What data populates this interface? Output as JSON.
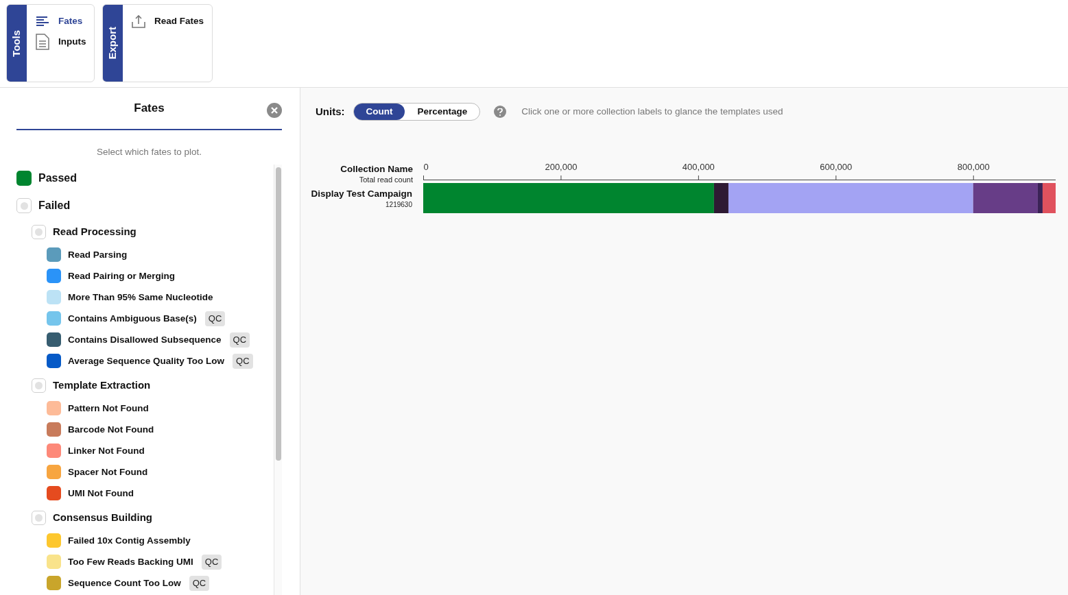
{
  "toolbar": [
    {
      "tab": "Tools",
      "items": [
        {
          "label": "Fates",
          "kind": "lines",
          "selected": true
        },
        {
          "label": "Inputs",
          "kind": "document",
          "selected": false
        }
      ]
    },
    {
      "tab": "Export",
      "items": [
        {
          "label": "Read Fates",
          "kind": "upload",
          "selected": false
        }
      ]
    }
  ],
  "panel": {
    "title": "Fates",
    "hint": "Select which fates to plot.",
    "fates": [
      {
        "label": "Passed",
        "checked": true,
        "color": "#00852f"
      },
      {
        "label": "Failed",
        "checked": false,
        "children": [
          {
            "label": "Read Processing",
            "checked": false,
            "children": [
              {
                "label": "Read Parsing",
                "checked": true,
                "color": "#5b9bbb"
              },
              {
                "label": "Read Pairing or Merging",
                "checked": true,
                "color": "#2a93f8"
              },
              {
                "label": "More Than 95% Same Nucleotide",
                "checked": true,
                "color": "#bce2f5"
              },
              {
                "label": "Contains Ambiguous Base(s)",
                "checked": true,
                "color": "#75c5ec",
                "badge": "QC"
              },
              {
                "label": "Contains Disallowed Subsequence",
                "checked": true,
                "color": "#375d70",
                "badge": "QC"
              },
              {
                "label": "Average Sequence Quality Too Low",
                "checked": true,
                "color": "#065ac7",
                "badge": "QC"
              }
            ]
          },
          {
            "label": "Template Extraction",
            "checked": false,
            "children": [
              {
                "label": "Pattern Not Found",
                "checked": true,
                "color": "#fdbb98"
              },
              {
                "label": "Barcode Not Found",
                "checked": true,
                "color": "#c87b5b"
              },
              {
                "label": "Linker Not Found",
                "checked": true,
                "color": "#fd8979"
              },
              {
                "label": "Spacer Not Found",
                "checked": true,
                "color": "#f7a540"
              },
              {
                "label": "UMI Not Found",
                "checked": true,
                "color": "#e54b1f"
              }
            ]
          },
          {
            "label": "Consensus Building",
            "checked": false,
            "children": [
              {
                "label": "Failed 10x Contig Assembly",
                "checked": true,
                "color": "#fdc72e"
              },
              {
                "label": "Too Few Reads Backing UMI",
                "checked": true,
                "color": "#f9e38b",
                "badge": "QC"
              },
              {
                "label": "Sequence Count Too Low",
                "checked": true,
                "color": "#c9a52b",
                "badge": "QC"
              }
            ]
          }
        ]
      }
    ]
  },
  "controls": {
    "label": "Units:",
    "options": [
      {
        "label": "Count",
        "selected": true
      },
      {
        "label": "Percentage",
        "selected": false
      }
    ],
    "help": "Click one or more collection labels to glance the templates used"
  },
  "chart": {
    "header": "Collection Name",
    "subheader": "Total read count",
    "rows": [
      {
        "total": "1219630"
      }
    ],
    "chart_data": {
      "type": "bar",
      "orientation": "horizontal",
      "stacked": true,
      "categories": [
        "Display Test Campaign"
      ],
      "xlim": [
        0,
        920000
      ],
      "xticks": [
        {
          "value": 0,
          "label": "0"
        },
        {
          "value": 200000,
          "label": "200,000"
        },
        {
          "value": 400000,
          "label": "400,000"
        },
        {
          "value": 600000,
          "label": "600,000"
        },
        {
          "value": 800000,
          "label": "800,000"
        }
      ],
      "series": [
        {
          "color": "#00852f",
          "values": [
            423000
          ]
        },
        {
          "color": "#2e1a33",
          "values": [
            21000
          ]
        },
        {
          "color": "#a3a3f3",
          "values": [
            356000
          ]
        },
        {
          "color": "#673d87",
          "values": [
            94000
          ]
        },
        {
          "color": "#3b2356",
          "values": [
            7000
          ]
        },
        {
          "color": "#e0525e",
          "values": [
            19000
          ]
        }
      ]
    }
  }
}
